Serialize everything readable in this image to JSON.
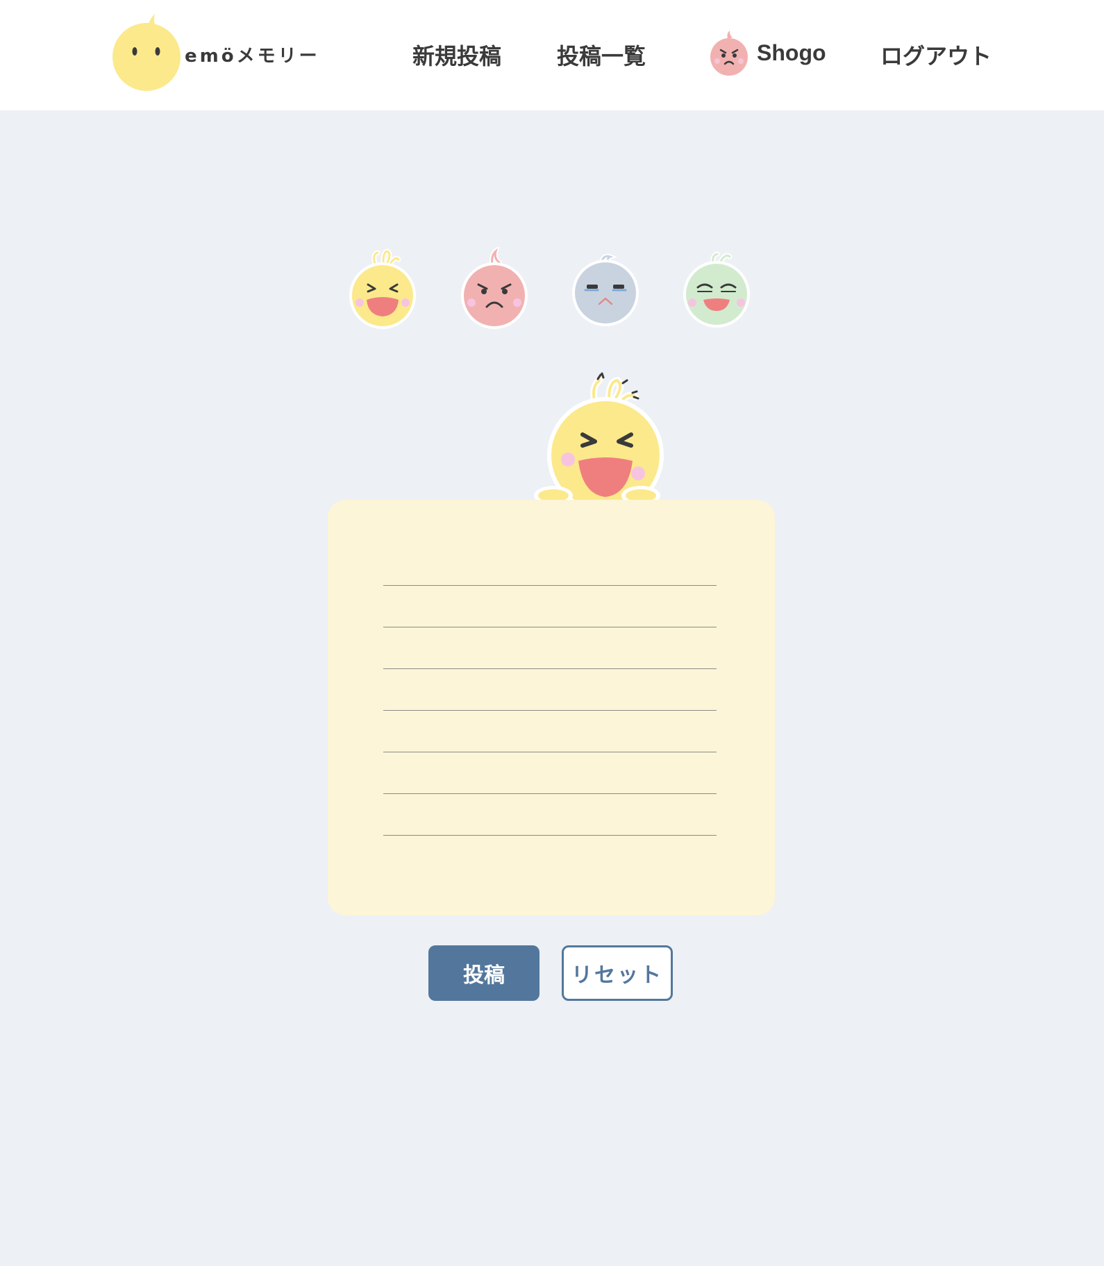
{
  "header": {
    "logo_text": "emöメモリー",
    "nav": {
      "new_post": "新規投稿",
      "post_list": "投稿一覧",
      "username": "Shogo",
      "logout": "ログアウト"
    }
  },
  "emotions": [
    {
      "name": "happy",
      "color": "#fbe98c"
    },
    {
      "name": "angry",
      "color": "#f2b1b1"
    },
    {
      "name": "sad",
      "color": "#c9d3e0"
    },
    {
      "name": "calm",
      "color": "#d2ebcf"
    }
  ],
  "form": {
    "text_value": "",
    "post_button": "投稿",
    "reset_button": "リセット"
  },
  "colors": {
    "background": "#edf0f5",
    "card": "#fdf5d7",
    "primary": "#53779c",
    "header": "#ffffff"
  }
}
